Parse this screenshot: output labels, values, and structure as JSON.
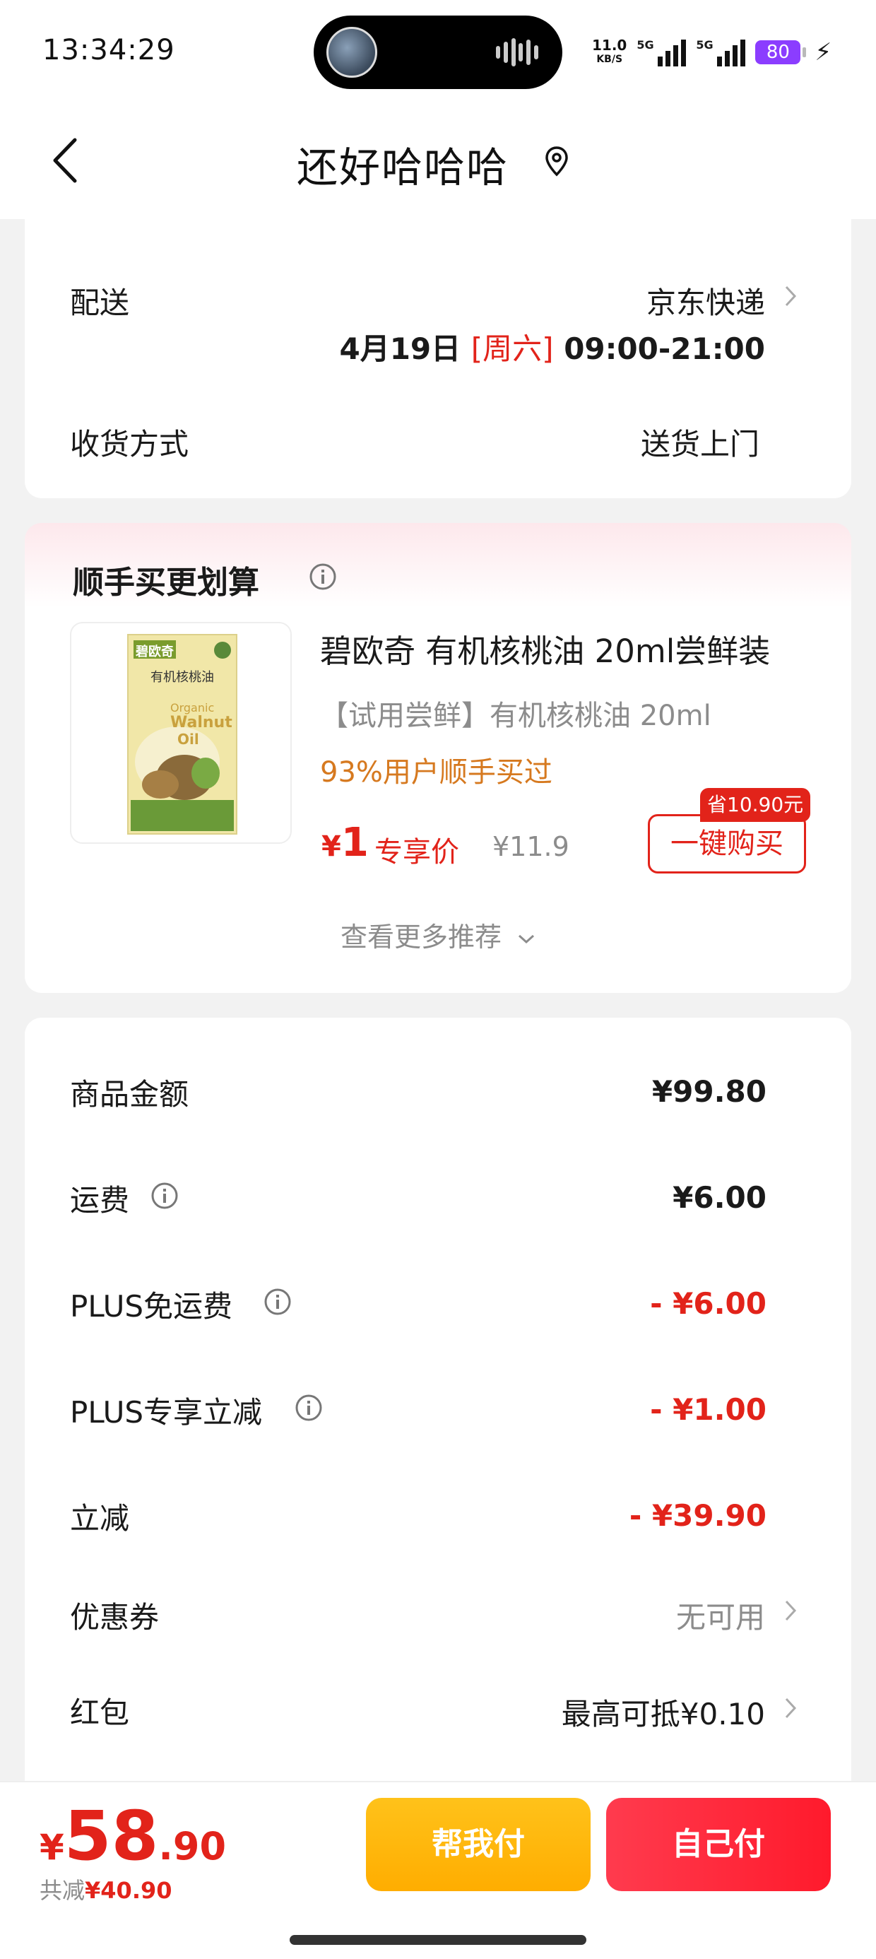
{
  "status_bar": {
    "time": "13:34:29",
    "net_speed": "11.0",
    "net_unit": "KB/S",
    "sig1": "5G",
    "sig2": "5G",
    "battery": "80"
  },
  "nav": {
    "title": "还好哈哈哈",
    "back_icon": "chevron-left-icon",
    "location_icon": "location-pin-icon"
  },
  "delivery": {
    "label": "配送",
    "carrier": "京东快递",
    "date": "4月19日",
    "weekday": "[周六]",
    "time_window": "09:00-21:00",
    "method_label": "收货方式",
    "method_value": "送货上门"
  },
  "recommend": {
    "title": "顺手买更划算",
    "product": {
      "name": "碧欧奇 有机核桃油 20ml尝鲜装",
      "subtitle": "【试用尝鲜】有机核桃油 20ml",
      "bought": "93%用户顺手买过",
      "currency": "¥",
      "price": "1",
      "price_tag": "专享价",
      "original_price": "¥11.9",
      "save_badge": "省10.90元",
      "buy_label": "一键购买",
      "image_brand": "碧欧奇",
      "image_name": "有机核桃油",
      "image_en1": "Organic",
      "image_en2": "Walnut",
      "image_en3": "Oil"
    },
    "more_label": "查看更多推荐"
  },
  "summary": {
    "rows": [
      {
        "label": "商品金额",
        "value": "¥99.80"
      },
      {
        "label": "运费",
        "value": "¥6.00"
      },
      {
        "label": "PLUS免运费",
        "value": "- ¥6.00"
      },
      {
        "label": "PLUS专享立减",
        "value": "- ¥1.00"
      },
      {
        "label": "立减",
        "value": "- ¥39.90"
      },
      {
        "label": "优惠券",
        "value": "无可用"
      },
      {
        "label": "红包",
        "value": "最高可抵¥0.10"
      }
    ]
  },
  "bottom": {
    "currency": "¥",
    "total_int": "58",
    "total_dec": ".90",
    "discount_label": "共减",
    "discount_value": "¥40.90",
    "help_pay": "帮我付",
    "self_pay": "自己付"
  },
  "colors": {
    "accent": "#e2231a",
    "help_btn": "#ffb300",
    "self_btn": "#ff2a3a",
    "bought": "#d6791f"
  }
}
